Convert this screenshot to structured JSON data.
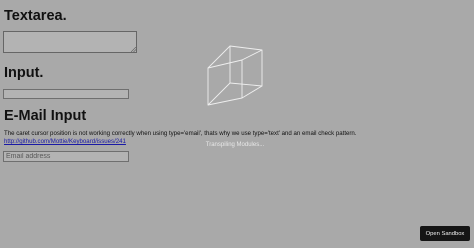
{
  "headings": {
    "textarea": "Textarea.",
    "input": "Input.",
    "email": "E-Mail Input"
  },
  "textarea": {
    "value": ""
  },
  "text_input": {
    "value": ""
  },
  "email_input": {
    "value": "",
    "placeholder": "Email address"
  },
  "description": "The caret cursor position is not working correctly when using type='email', thats why we use type='text' and an email check pattern.",
  "issue_link": "http://github.com/Mottie/Keyboard/issues/241",
  "loader": {
    "status": "Transpiling Modules..."
  },
  "sandbox_button": "Open Sandbox",
  "colors": {
    "page_background": "#a9a9a9",
    "field_background": "#b3b3b3",
    "button_background": "#151515",
    "link": "#1a1aa6"
  },
  "icons": {
    "loader": "wireframe-cube-icon"
  }
}
